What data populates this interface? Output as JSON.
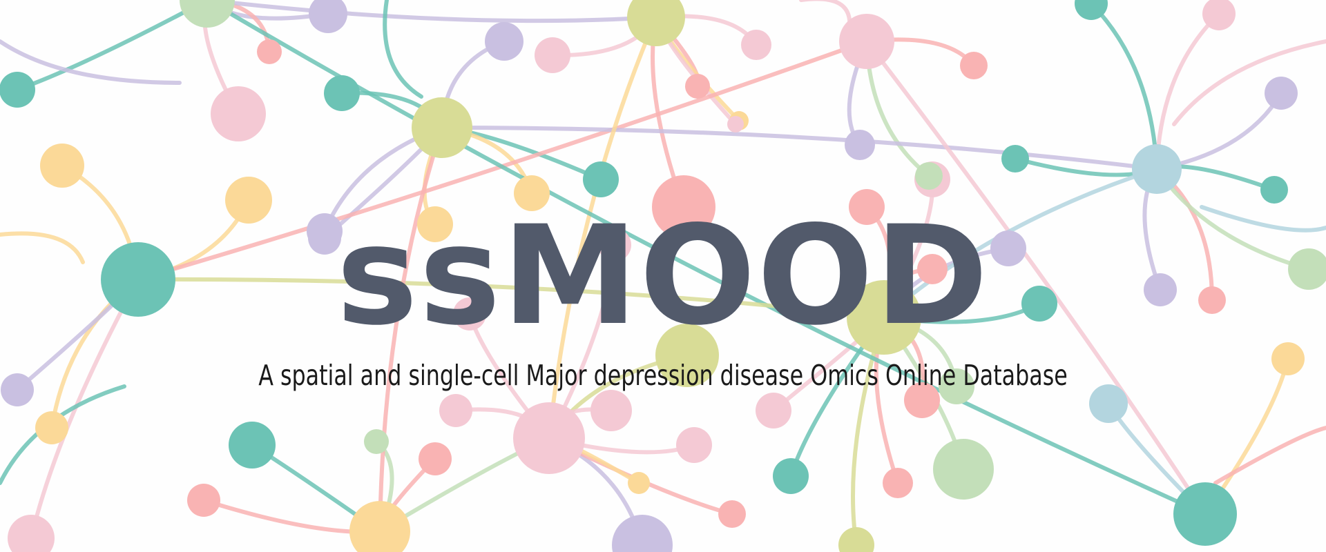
{
  "hero": {
    "title": "ssMOOD",
    "subtitle": "A spatial and single-cell Major depression disease Omics Online Database"
  },
  "colors": {
    "title": "#525a6b",
    "subtitle": "#1a1a1a",
    "node_palette": [
      "#6cc3b5",
      "#d8dc96",
      "#f9b3b3",
      "#c9c0e1",
      "#fbd998",
      "#f4c9d4",
      "#b3d5df",
      "#c3dfb9"
    ]
  }
}
